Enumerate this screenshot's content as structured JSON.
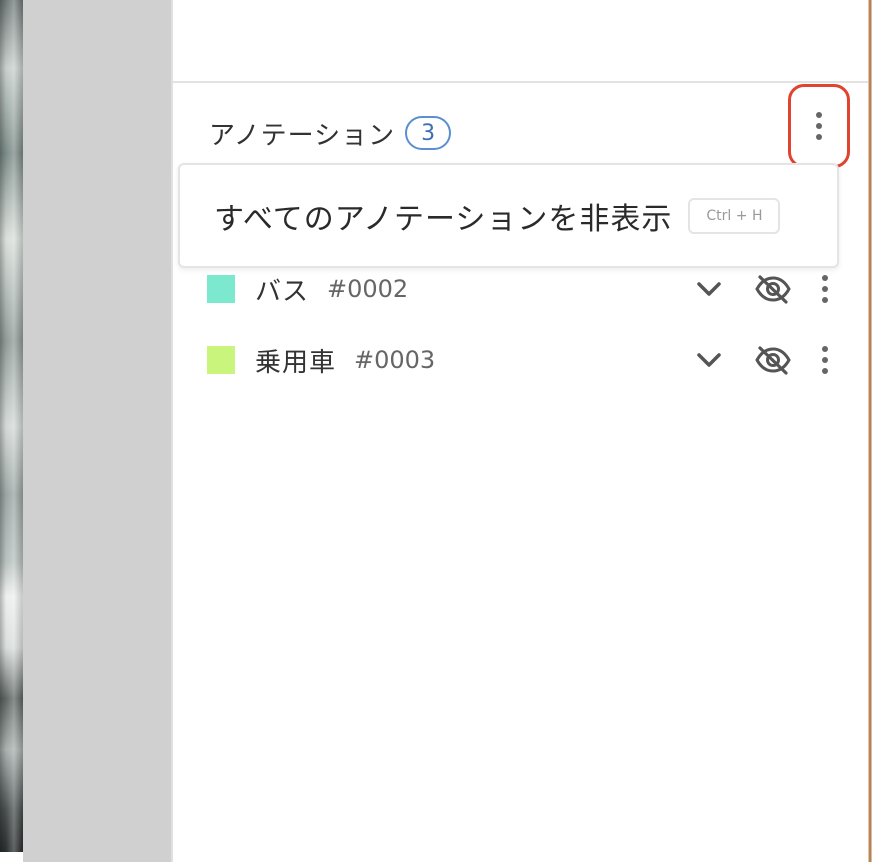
{
  "panel": {
    "title": "アノテーション",
    "count": "3"
  },
  "menu": {
    "items": [
      {
        "label": "すべてのアノテーションを非表示",
        "shortcut": "Ctrl + H"
      }
    ]
  },
  "annotations": [
    {
      "label": "バス",
      "id": "#0002",
      "color": "#7ce9cf"
    },
    {
      "label": "乗用車",
      "id": "#0003",
      "color": "#c9f57c"
    }
  ],
  "icons": {
    "expand": "chevron-down-icon",
    "visibility": "eye-off-icon",
    "more": "more-vertical-icon"
  },
  "colors": {
    "badge_accent": "#5b8fd0",
    "highlight_border": "#e0432e"
  }
}
